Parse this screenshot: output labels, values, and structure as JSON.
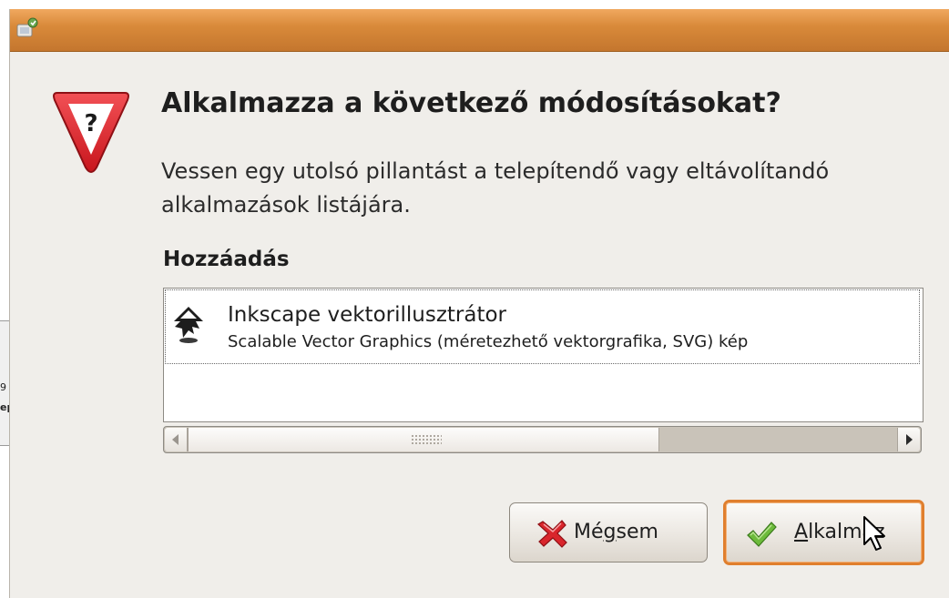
{
  "background_window": {
    "line1": "9",
    "line2": "ep"
  },
  "dialog": {
    "titlebar_icon": "software-properties-icon",
    "heading": "Alkalmazza a következő módosításokat?",
    "description": "Vessen egy utolsó pillantást a telepítendő vagy eltávolítandó alkalmazások listájára.",
    "section_label": "Hozzáadás",
    "packages": [
      {
        "icon": "inkscape-icon",
        "name": "Inkscape vektorillusztrátor",
        "description": "Scalable Vector Graphics (méretezhető vektorgrafika, SVG) kép"
      }
    ],
    "buttons": {
      "cancel_label": "Mégsem",
      "cancel_mnemonic": "g",
      "apply_label": "Alkalmaz",
      "apply_mnemonic": "A"
    }
  },
  "colors": {
    "titlebar": "#d98a3a",
    "focus_ring": "#e07f2e",
    "warning_red": "#e0252b"
  }
}
